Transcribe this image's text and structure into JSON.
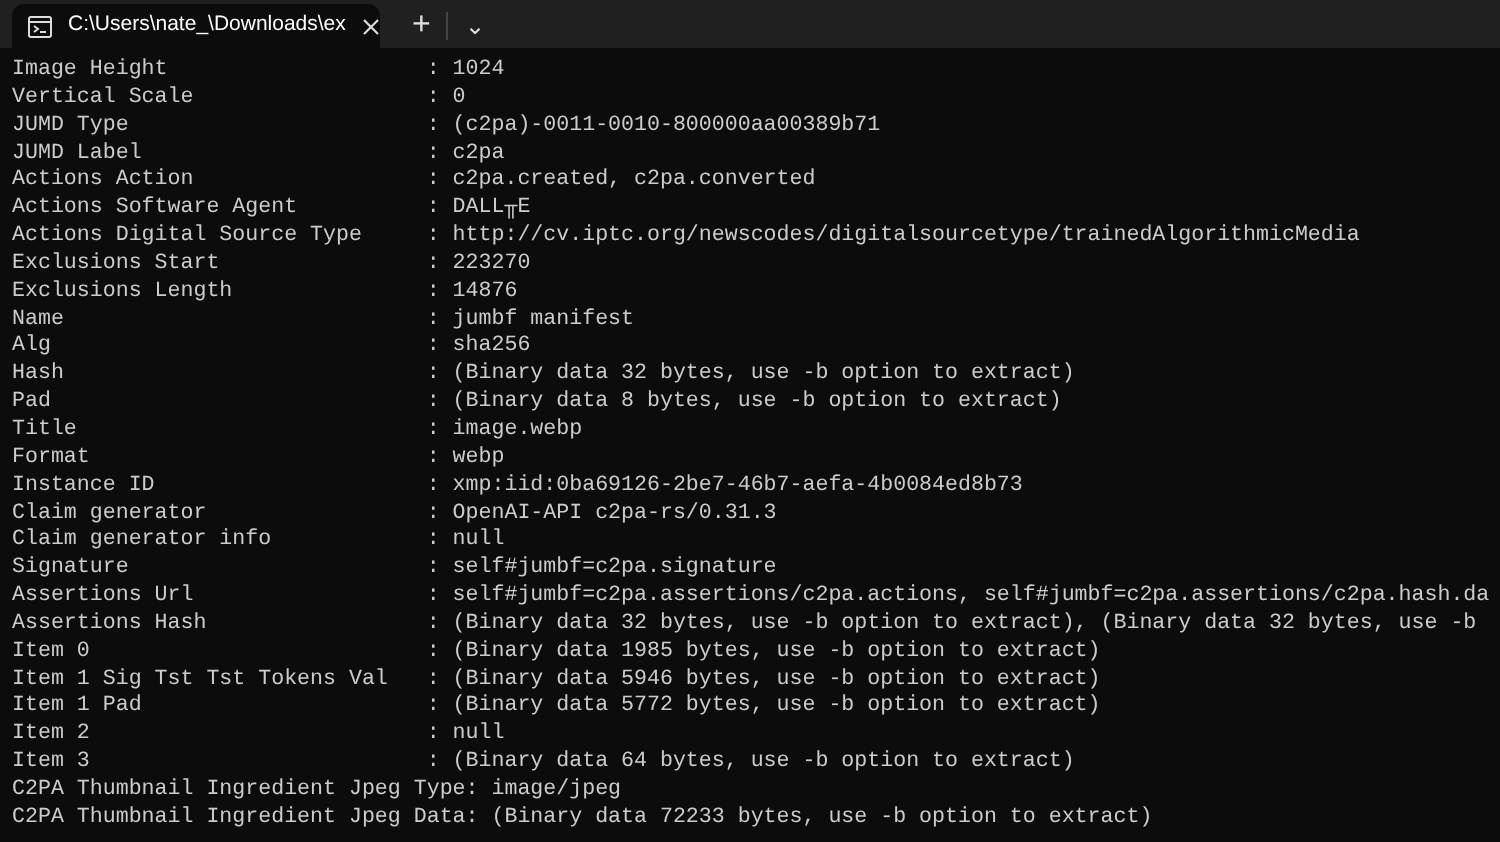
{
  "tabs": [
    {
      "title": "C:\\Users\\nate_\\Downloads\\ex",
      "selected": true
    }
  ],
  "tab_bar": {
    "new_tab": "+",
    "dropdown": "⌄"
  },
  "terminal": {
    "lines": [
      "Image Height                    : 1024",
      "Vertical Scale                  : 0",
      "JUMD Type                       : (c2pa)-0011-0010-800000aa00389b71",
      "JUMD Label                      : c2pa",
      "Actions Action                  : c2pa.created, c2pa.converted",
      "Actions Software Agent          : DALL╥E",
      "Actions Digital Source Type     : http://cv.iptc.org/newscodes/digitalsourcetype/trainedAlgorithmicMedia",
      "Exclusions Start                : 223270",
      "Exclusions Length               : 14876",
      "Name                            : jumbf manifest",
      "Alg                             : sha256",
      "Hash                            : (Binary data 32 bytes, use -b option to extract)",
      "Pad                             : (Binary data 8 bytes, use -b option to extract)",
      "Title                           : image.webp",
      "Format                          : webp",
      "Instance ID                     : xmp:iid:0ba69126-2be7-46b7-aefa-4b0084ed8b73",
      "Claim generator                 : OpenAI-API c2pa-rs/0.31.3",
      "Claim generator info            : null",
      "Signature                       : self#jumbf=c2pa.signature",
      "Assertions Url                  : self#jumbf=c2pa.assertions/c2pa.actions, self#jumbf=c2pa.assertions/c2pa.hash.da",
      "Assertions Hash                 : (Binary data 32 bytes, use -b option to extract), (Binary data 32 bytes, use -b",
      "Item 0                          : (Binary data 1985 bytes, use -b option to extract)",
      "Item 1 Sig Tst Tst Tokens Val   : (Binary data 5946 bytes, use -b option to extract)",
      "Item 1 Pad                      : (Binary data 5772 bytes, use -b option to extract)",
      "Item 2                          : null",
      "Item 3                          : (Binary data 64 bytes, use -b option to extract)",
      "C2PA Thumbnail Ingredient Jpeg Type: image/jpeg",
      "C2PA Thumbnail Ingredient Jpeg Data: (Binary data 72233 bytes, use -b option to extract)"
    ]
  }
}
